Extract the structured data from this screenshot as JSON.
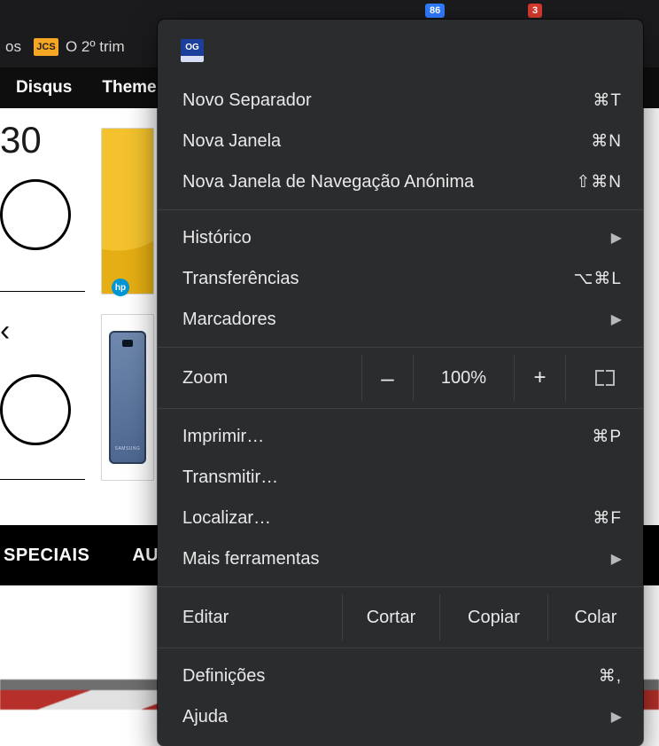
{
  "strip": {
    "badge86": "86",
    "badge3": "3"
  },
  "bookmarks": {
    "os_suffix": "os",
    "jcs_icon_text": "JCS",
    "trim_text": "O 2º trim"
  },
  "nav": {
    "item1": "Disqus",
    "item2": "Theme"
  },
  "page": {
    "big80": "30",
    "bigk": "‹",
    "phone_brand": "SAMSUNG",
    "especiais": "SPECIAIS",
    "au": "AU"
  },
  "menu": {
    "og": "OG",
    "new_tab": {
      "label": "Novo Separador",
      "shortcut": "⌘T"
    },
    "new_window": {
      "label": "Nova Janela",
      "shortcut": "⌘N"
    },
    "incognito": {
      "label": "Nova Janela de Navegação Anónima",
      "shortcut": "⇧⌘N"
    },
    "history": {
      "label": "Histórico"
    },
    "downloads": {
      "label": "Transferências",
      "shortcut": "⌥⌘L"
    },
    "bookmarks": {
      "label": "Marcadores"
    },
    "zoom": {
      "label": "Zoom",
      "minus": "–",
      "pct": "100%",
      "plus": "+"
    },
    "print": {
      "label": "Imprimir…",
      "shortcut": "⌘P"
    },
    "cast": {
      "label": "Transmitir…"
    },
    "find": {
      "label": "Localizar…",
      "shortcut": "⌘F"
    },
    "more_tools": {
      "label": "Mais ferramentas"
    },
    "edit": {
      "label": "Editar",
      "cut": "Cortar",
      "copy": "Copiar",
      "paste": "Colar"
    },
    "settings": {
      "label": "Definições",
      "shortcut": "⌘,"
    },
    "help": {
      "label": "Ajuda"
    }
  }
}
